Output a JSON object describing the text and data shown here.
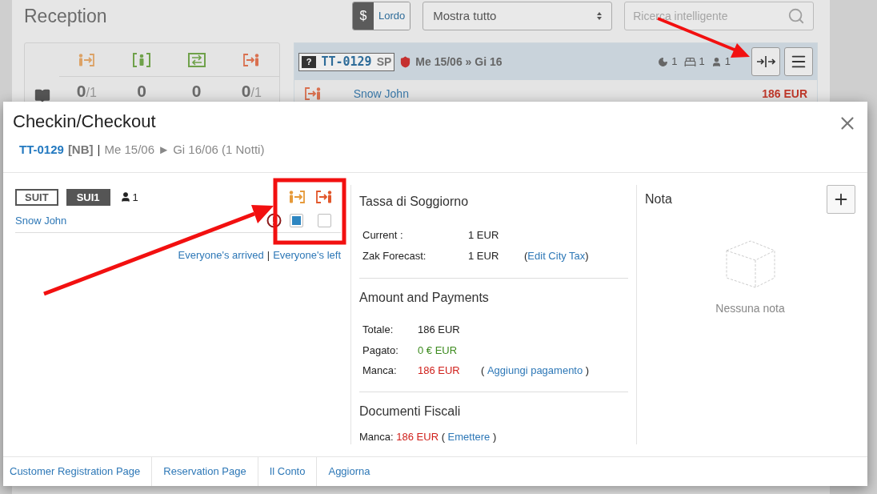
{
  "background_page": {
    "title": "Reception",
    "currency_button": {
      "symbol": "$",
      "label": "Lordo"
    },
    "filter_select": {
      "value": "Mostra tutto"
    },
    "search": {
      "placeholder": "Ricerca intelligente"
    },
    "stats": [
      {
        "kind": "arrival",
        "value": "0",
        "total": "/1"
      },
      {
        "kind": "inhouse",
        "value": "0"
      },
      {
        "kind": "swap",
        "value": "0"
      },
      {
        "kind": "departure",
        "value": "0",
        "total": "/1"
      }
    ],
    "booking": {
      "room_badge": "?",
      "code": "TT-0129",
      "tag": "SP",
      "dates": "Me 15/06 » Gi 16",
      "nights": "1",
      "beds": "1",
      "guests": "1",
      "guest": "Snow John",
      "amount": "186 EUR"
    }
  },
  "modal": {
    "title": "Checkin/Checkout",
    "code": "TT-0129",
    "tag": "[NB]",
    "separator": "|",
    "dates": "Me 15/06 ► Gi 16/06 (1 Notti)",
    "room": {
      "type": "SUIT",
      "name": "SUI1",
      "guests": "1",
      "guest": "Snow John",
      "checkin": {
        "checked": true
      },
      "checkout": {
        "checked": false
      }
    },
    "bulk_links": [
      "Everyone's arrived",
      "|",
      "Everyone's left"
    ],
    "city_tax": {
      "title": "Tassa di Soggiorno",
      "rows": [
        {
          "label": "Current :",
          "value": "1 EUR"
        },
        {
          "label": "Zak Forecast:",
          "value": "1 EUR",
          "link": "Edit City Tax",
          "open": "(",
          "close": ")"
        }
      ]
    },
    "payments": {
      "title": "Amount and Payments",
      "rows": [
        {
          "label": "Totale:",
          "value": "186 EUR",
          "color": "#222222"
        },
        {
          "label": "Pagato:",
          "value": "0 € EUR",
          "color": "#3d8b1f"
        },
        {
          "label": "Manca:",
          "value": "186 EUR",
          "color": "#d0201b",
          "link": "Aggiungi pagamento",
          "open": "( ",
          "close": " )"
        }
      ]
    },
    "fiscal": {
      "title": "Documenti Fiscali",
      "label": "Manca:",
      "value": "186 EUR",
      "open": "( ",
      "link": "Emettere",
      "close": " )"
    },
    "note": {
      "title": "Nota",
      "empty": "Nessuna nota"
    },
    "footer_links": [
      "Customer Registration Page",
      "Reservation Page",
      "Il Conto",
      "Aggiorna"
    ]
  }
}
